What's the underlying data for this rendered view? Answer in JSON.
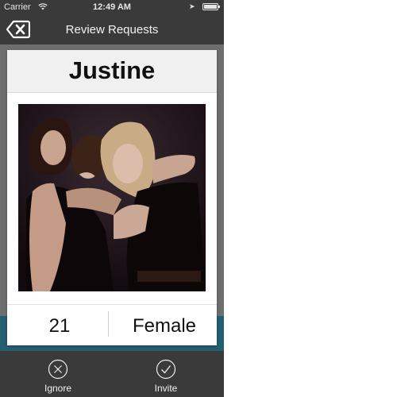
{
  "status_bar": {
    "carrier": "Carrier",
    "time": "12:49 AM"
  },
  "nav": {
    "title": "Review Requests",
    "back_icon": "close-back-icon"
  },
  "profile": {
    "name": "Justine",
    "age": "21",
    "gender": "Female",
    "photo_icon": "profile-photo"
  },
  "toolbar": {
    "ignore_label": "Ignore",
    "invite_label": "Invite",
    "ignore_icon": "circle-x-icon",
    "invite_icon": "circle-check-icon"
  },
  "colors": {
    "bar_bg": "#3a3a3a",
    "backdrop": "#6e6e6e",
    "teal_band": "#245f72",
    "card_bg": "#ffffff"
  }
}
